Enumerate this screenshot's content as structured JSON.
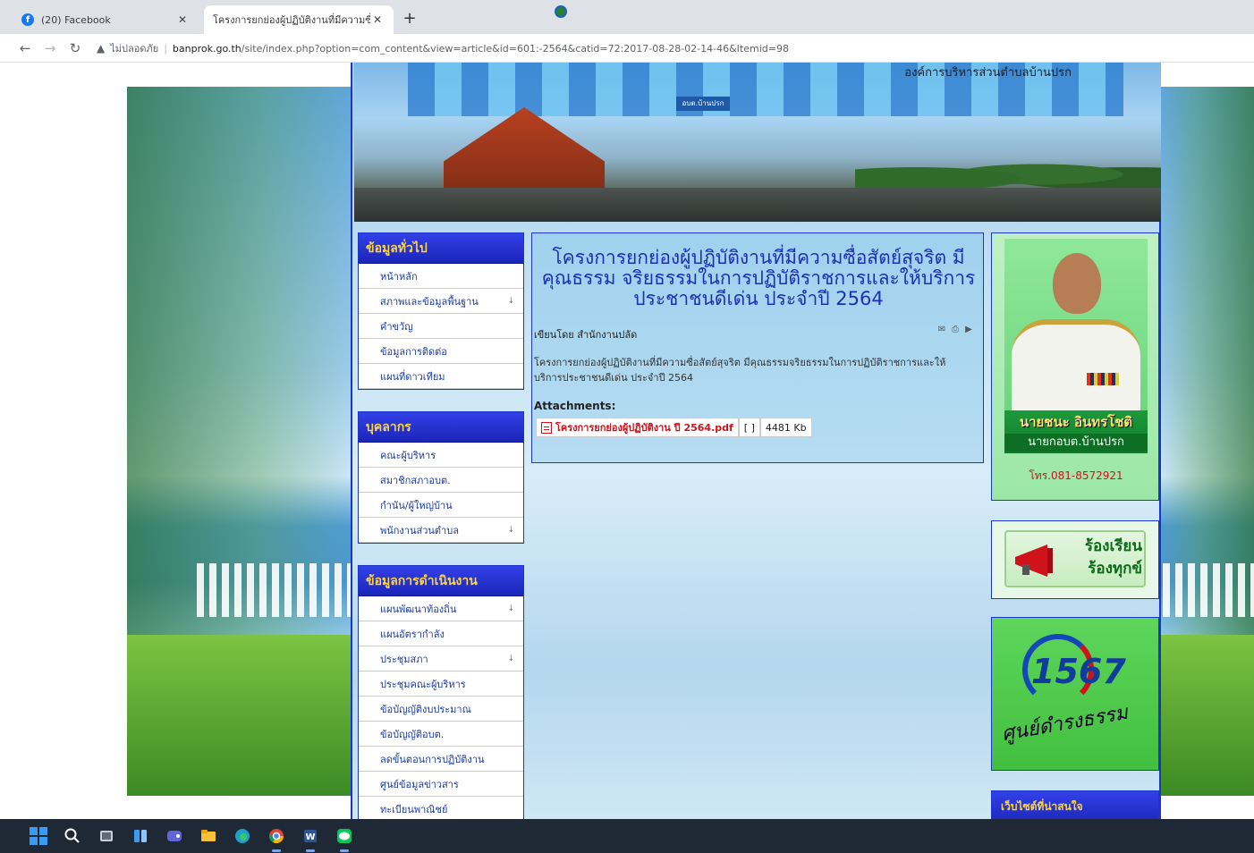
{
  "browser": {
    "tabs": [
      {
        "title": "(20) Facebook",
        "active": false,
        "favicon": "facebook-icon"
      },
      {
        "title": "โครงการยกย่องผู้ปฏิบัติงานที่มีความซื่อ",
        "active": true,
        "favicon": "site-emblem-icon"
      }
    ],
    "new_tab": "+",
    "address": {
      "security_label": "ไม่ปลอดภัย",
      "host": "banprok.go.th",
      "path": "/site/index.php?option=com_content&view=article&id=601:-2564&catid=72:2017-08-28-02-14-46&Itemid=98"
    }
  },
  "banner": {
    "text": "องค์การบริหารส่วนตำบลบ้านปรก",
    "signboard": "อบต.บ้านปรก"
  },
  "left_modules": [
    {
      "title": "ข้อมูลทั่วไป",
      "items": [
        {
          "label": "หน้าหลัก",
          "arrow": ""
        },
        {
          "label": "สภาพและข้อมูลพื้นฐาน",
          "arrow": "↓"
        },
        {
          "label": "คำขวัญ",
          "arrow": ""
        },
        {
          "label": "ข้อมูลการติดต่อ",
          "arrow": ""
        },
        {
          "label": "แผนที่ดาวเทียม",
          "arrow": ""
        }
      ]
    },
    {
      "title": "บุคลากร",
      "items": [
        {
          "label": "คณะผู้บริหาร",
          "arrow": ""
        },
        {
          "label": "สมาชิกสภาอบต.",
          "arrow": ""
        },
        {
          "label": "กำนัน/ผู้ใหญ่บ้าน",
          "arrow": ""
        },
        {
          "label": "พนักงานส่วนตำบล",
          "arrow": "↓"
        }
      ]
    },
    {
      "title": "ข้อมูลการดำเนินงาน",
      "items": [
        {
          "label": "แผนพัฒนาท้องถิ่น",
          "arrow": "↓"
        },
        {
          "label": "แผนอัตรากำลัง",
          "arrow": ""
        },
        {
          "label": "ประชุมสภา",
          "arrow": "↓"
        },
        {
          "label": "ประชุมคณะผู้บริหาร",
          "arrow": ""
        },
        {
          "label": "ข้อบัญญัติงบประมาณ",
          "arrow": ""
        },
        {
          "label": "ข้อบัญญัติอบต.",
          "arrow": ""
        },
        {
          "label": "ลดขั้นตอนการปฏิบัติงาน",
          "arrow": ""
        },
        {
          "label": "ศูนย์ข้อมูลข่าวสาร",
          "arrow": ""
        },
        {
          "label": "ทะเบียนพาณิชย์",
          "arrow": ""
        }
      ]
    }
  ],
  "article": {
    "title": "โครงการยกย่องผู้ปฏิบัติงานที่มีความซื่อสัตย์สุจริต มีคุณธรรม จริยธรรมในการปฏิบัติราชการและให้บริการประชาชนดีเด่น ประจำปี 2564",
    "byline": "เขียนโดย สำนักงานปลัด",
    "body": "โครงการยกย่องผู้ปฏิบัติงานที่มีความซื่อสัตย์สุจริต มีคุณธรรมจริยธรรมในการปฏิบัติราชการและให้บริการประชาชนดีเด่น ประจำปี 2564",
    "attachments_label": "Attachments:",
    "attachment": {
      "name": "โครงการยกย่องผู้ปฏิบัติงาน ปี 2564.pdf",
      "bracket": "[ ]",
      "size": "4481 Kb"
    },
    "icons": [
      "email-icon",
      "print-icon",
      "pdf-export-icon"
    ]
  },
  "right_column": {
    "executive": {
      "name": "นายชนะ อินทรโชติ",
      "position": "นายกอบต.บ้านปรก",
      "phone": "โทร.081-8572921"
    },
    "complaint": {
      "line1": "ร้องเรียน",
      "line2": "ร้องทุกข์"
    },
    "center": {
      "number": "1567",
      "caption": "ศูนย์ดำรงธรรม"
    },
    "links_title": "เว็บไซต์ที่น่าสนใจ"
  },
  "colors": {
    "module_header": "#1a26b8",
    "module_title": "#ffd43b",
    "link": "#1a3aa8",
    "article_title": "#1c2fb8",
    "attachment": "#d0121b"
  }
}
